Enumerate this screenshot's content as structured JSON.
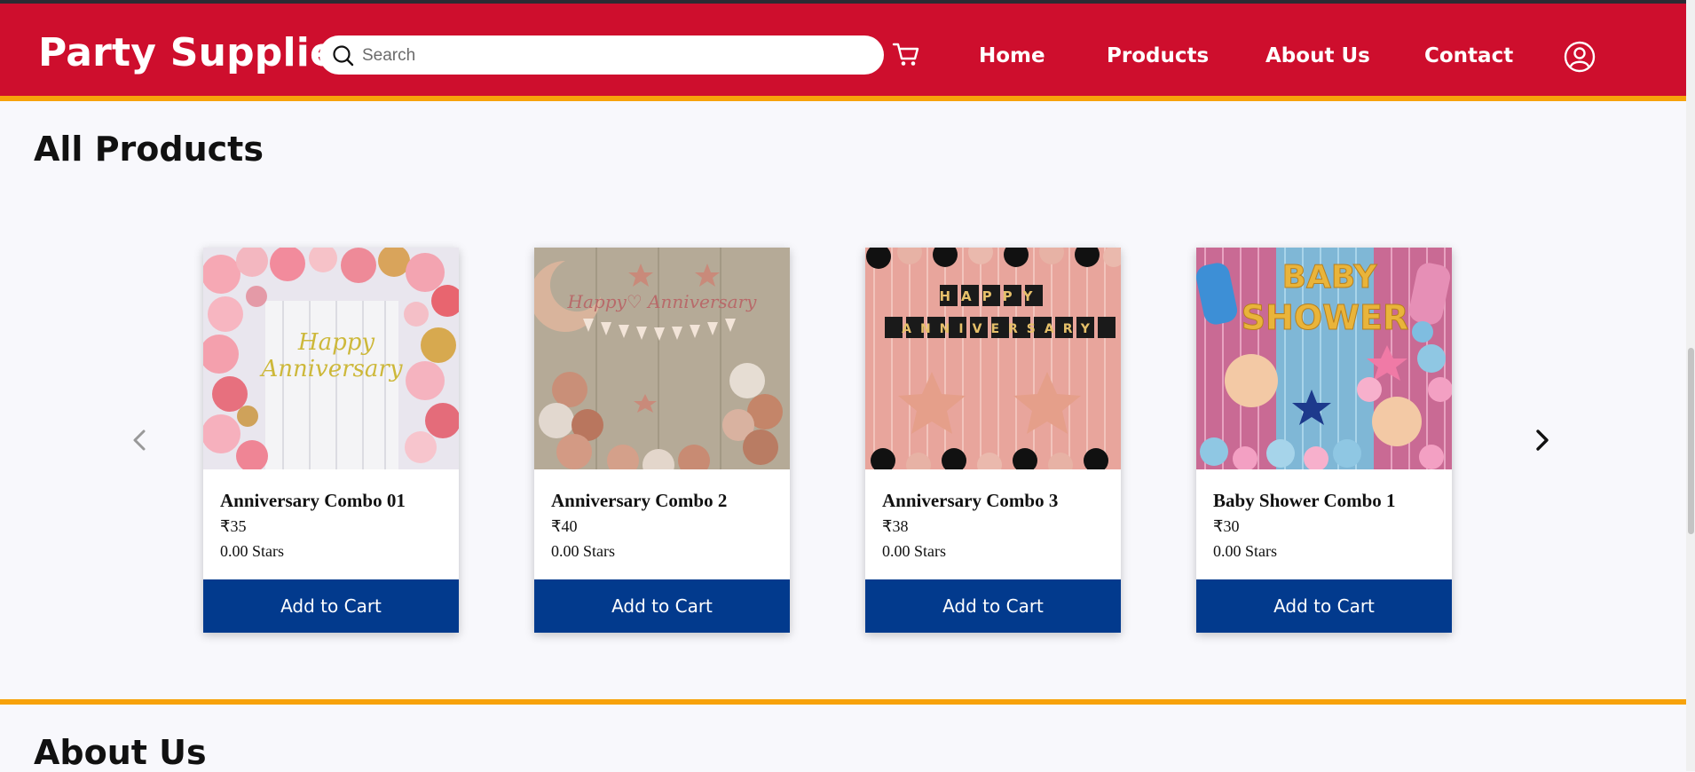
{
  "header": {
    "brand": "Party Supplies",
    "search": {
      "placeholder": "Search",
      "value": ""
    },
    "nav": [
      "Home",
      "Products",
      "About Us",
      "Contact"
    ],
    "icons": {
      "search": "search-icon",
      "cart": "cart-icon",
      "user": "user-account-icon"
    }
  },
  "products_section": {
    "title": "All Products",
    "prev_icon": "chevron-left-icon",
    "next_icon": "chevron-right-icon",
    "products": [
      {
        "name": "Anniversary Combo 01",
        "price": "₹35",
        "rating": "0.00 Stars",
        "button": "Add to Cart",
        "image_text": "Happy Anniversary"
      },
      {
        "name": "Anniversary Combo 2",
        "price": "₹40",
        "rating": "0.00 Stars",
        "button": "Add to Cart",
        "image_text": "Happy Anniversary"
      },
      {
        "name": "Anniversary Combo 3",
        "price": "₹38",
        "rating": "0.00 Stars",
        "button": "Add to Cart",
        "image_text": "HAPPY ANNIVERSARY"
      },
      {
        "name": "Baby Shower Combo 1",
        "price": "₹30",
        "rating": "0.00 Stars",
        "button": "Add to Cart",
        "image_text": "BABY SHOWER"
      }
    ]
  },
  "about_section": {
    "title": "About Us"
  },
  "colors": {
    "header_bg": "#ce0e2d",
    "accent_line": "#f7a20b",
    "button_bg": "#023a8d",
    "page_bg": "#f8f8fc"
  }
}
